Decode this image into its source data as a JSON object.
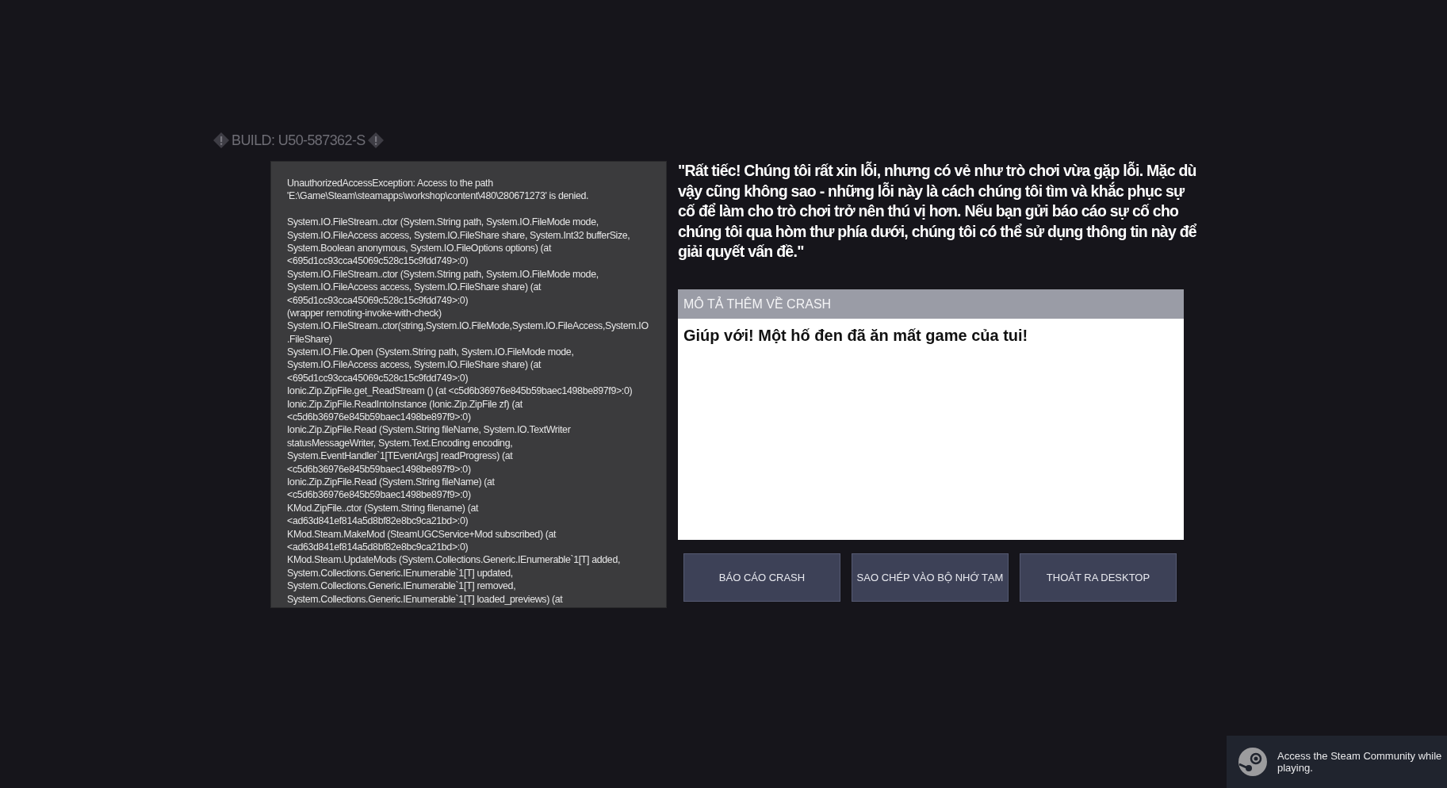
{
  "build_label": "BUILD: U50-587362-S",
  "error_log": {
    "message": [
      "UnauthorizedAccessException: Access to the path",
      "'E:\\Game\\Steam\\steamapps\\workshop\\content\\480\\280671273' is denied."
    ],
    "lines": [
      "System.IO.FileStream..ctor (System.String path, System.IO.FileMode mode,",
      "System.IO.FileAccess access, System.IO.FileShare share, System.Int32 bufferSize,",
      "System.Boolean anonymous, System.IO.FileOptions options) (at",
      "<695d1cc93cca45069c528c15c9fdd749>:0)",
      "System.IO.FileStream..ctor (System.String path, System.IO.FileMode mode,",
      "System.IO.FileAccess access, System.IO.FileShare share) (at",
      "<695d1cc93cca45069c528c15c9fdd749>:0)",
      "(wrapper remoting-invoke-with-check)",
      "System.IO.FileStream..ctor(string,System.IO.FileMode,System.IO.FileAccess,System.IO",
      ".FileShare)",
      "System.IO.File.Open (System.String path, System.IO.FileMode mode,",
      "System.IO.FileAccess access, System.IO.FileShare share) (at",
      "<695d1cc93cca45069c528c15c9fdd749>:0)",
      "Ionic.Zip.ZipFile.get_ReadStream () (at <c5d6b36976e845b59baec1498be897f9>:0)",
      "Ionic.Zip.ZipFile.ReadIntoInstance (Ionic.Zip.ZipFile zf) (at",
      "<c5d6b36976e845b59baec1498be897f9>:0)",
      "Ionic.Zip.ZipFile.Read (System.String fileName, System.IO.TextWriter",
      "statusMessageWriter, System.Text.Encoding encoding,",
      "System.EventHandler`1[TEventArgs] readProgress) (at",
      "<c5d6b36976e845b59baec1498be897f9>:0)",
      "Ionic.Zip.ZipFile.Read (System.String fileName) (at",
      "<c5d6b36976e845b59baec1498be897f9>:0)",
      "KMod.ZipFile..ctor (System.String filename) (at",
      "<ad63d841ef814a5d8bf82e8bc9ca21bd>:0)",
      "KMod.Steam.MakeMod (SteamUGCService+Mod subscribed) (at",
      "<ad63d841ef814a5d8bf82e8bc9ca21bd>:0)",
      "KMod.Steam.UpdateMods (System.Collections.Generic.IEnumerable`1[T] added,",
      "System.Collections.Generic.IEnumerable`1[T] updated,",
      "System.Collections.Generic.IEnumerable`1[T] removed,",
      "System.Collections.Generic.IEnumerable`1[T] loaded_previews) (at"
    ]
  },
  "apology": "\"Rất tiếc! Chúng tôi rất xin lỗi, nhưng có vẻ như trò chơi vừa gặp lỗi. Mặc dù vậy cũng không sao - những lỗi này là cách chúng tôi tìm và khắc phục sự cố để làm cho trò chơi trở nên thú vị hơn. Nếu bạn gửi báo cáo sự cố cho chúng tôi qua hòm thư phía dưới, chúng tôi có thể sử dụng thông tin này để giải quyết vấn đề.\"",
  "description": {
    "label": "MÔ TẢ THÊM VỀ CRASH",
    "value": "Giúp với! Một hố đen đã ăn mất game của tui!"
  },
  "buttons": [
    "BÁO CÁO CRASH",
    "SAO CHÉP VÀO BỘ NHỚ TẠM",
    "THOÁT RA DESKTOP"
  ],
  "steam_toast": {
    "text": "Access the Steam Community while playing."
  }
}
